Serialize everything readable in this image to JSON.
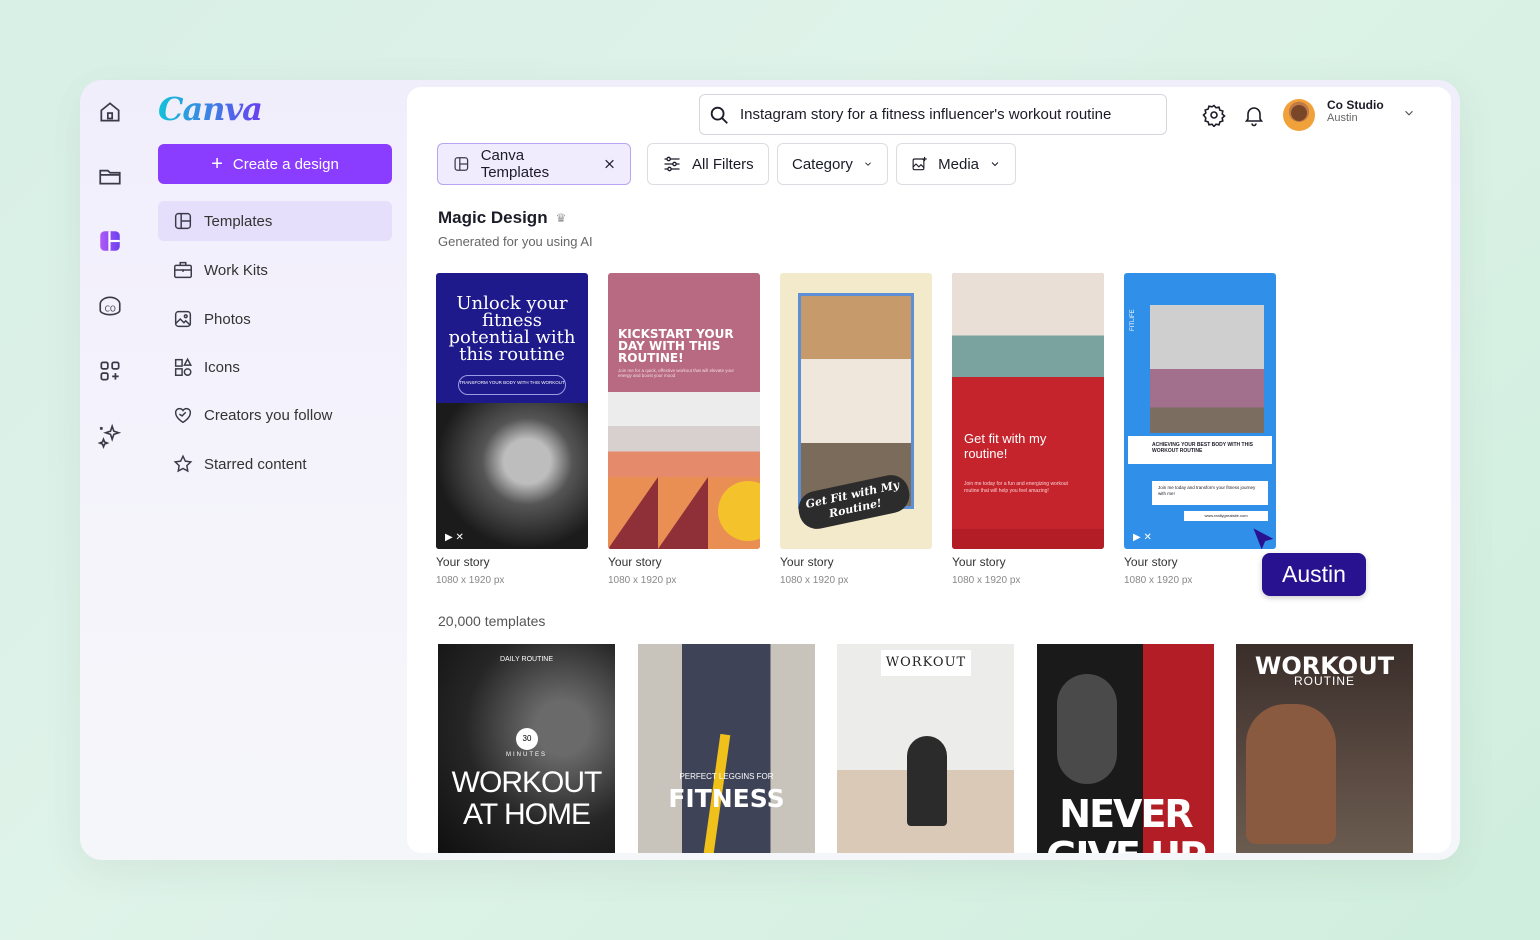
{
  "app": {
    "logo": "Canva"
  },
  "sidebar": {
    "create_label": "Create a design",
    "items": [
      {
        "label": "Templates",
        "icon": "template-icon",
        "active": true
      },
      {
        "label": "Work Kits",
        "icon": "briefcase-icon"
      },
      {
        "label": "Photos",
        "icon": "photo-icon"
      },
      {
        "label": "Icons",
        "icon": "shapes-icon"
      },
      {
        "label": "Creators you follow",
        "icon": "heart-icon"
      },
      {
        "label": "Starred content",
        "icon": "star-icon"
      }
    ]
  },
  "rail": [
    "home-icon",
    "folder-icon",
    "templates-icon",
    "canva-pro-icon",
    "apps-icon",
    "magic-icon"
  ],
  "search": {
    "value": "Instagram story for a fitness influencer's workout routine"
  },
  "account": {
    "name": "Co Studio",
    "sub": "Austin"
  },
  "filters": {
    "selected": "Canva Templates",
    "all_filters": "All Filters",
    "category": "Category",
    "media": "Media"
  },
  "magic": {
    "title": "Magic Design",
    "subtitle": "Generated for you using AI"
  },
  "cards": [
    {
      "title": "Your story",
      "dim": "1080 x 1920 px",
      "headline": "Unlock your fitness potential with this routine",
      "pill": "TRANSFORM YOUR BODY WITH THIS WORKOUT"
    },
    {
      "title": "Your story",
      "dim": "1080 x 1920 px",
      "headline": "KICKSTART YOUR DAY WITH THIS ROUTINE!",
      "body": "Join me for a quick, effective workout that will elevate your energy and boost your mood"
    },
    {
      "title": "Your story",
      "dim": "1080 x 1920 px",
      "headline": "Get Fit with My Routine!"
    },
    {
      "title": "Your story",
      "dim": "1080 x 1920 px",
      "headline": "Get fit with my routine!",
      "body": "Join me today for a fun and energizing workout routine that will help you feel amazing!"
    },
    {
      "title": "Your story",
      "dim": "1080 x 1920 px",
      "tag": "FITLIFE",
      "headline": "ACHIEVING YOUR BEST BODY WITH THIS WORKOUT ROUTINE",
      "body": "Join me today and transform your fitness journey with me!",
      "url": "www.reallygreatsite.com"
    }
  ],
  "templates_count": "20,000 templates",
  "templates": [
    {
      "kicker": "DAILY ROUTINE",
      "badge": "30",
      "badge_sub": "MINUTES",
      "line1": "WORKOUT",
      "line2": "AT HOME"
    },
    {
      "kicker": "PERFECT LEGGINS FOR",
      "line1": "FITNESS"
    },
    {
      "line1": "WORKOUT"
    },
    {
      "line1": "NEVER",
      "line2": "GIVE UP"
    },
    {
      "line1": "WORKOUT",
      "line2": "ROUTINE"
    }
  ],
  "cursor": {
    "label": "Austin"
  },
  "colors": {
    "accent": "#8b3dff",
    "cursor_bg": "#28128f",
    "active_nav": "#e6dffb"
  }
}
